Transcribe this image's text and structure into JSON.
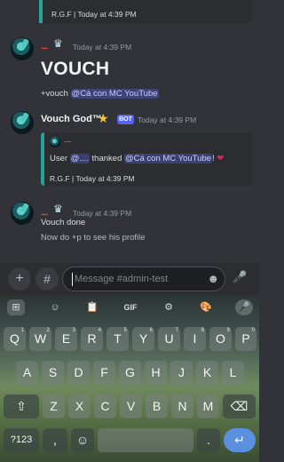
{
  "messages": {
    "top_footer": "R.G.F | Today at 4:39 PM",
    "msg1": {
      "username": "......",
      "time": "Today at 4:39 PM",
      "title": "VOUCH",
      "line_prefix": "+vouch ",
      "mention": "@Cá con MC YouTube"
    },
    "msg2": {
      "username": "Vouch God™",
      "bot_tag": "BOT",
      "time": "Today at 4:39 PM",
      "embed_author": "....",
      "body_prefix": "User ",
      "body_mention1": "@....",
      "body_mid": " thanked ",
      "body_mention2": "@Cá con MC YouTube",
      "body_suffix": "!",
      "heart": "❤",
      "footer": "R.G.F | Today at 4:39 PM"
    },
    "msg3": {
      "username": "......",
      "time": "Today at 4:39 PM",
      "line1": "Vouch done",
      "line2": "Now do +p to see his profile"
    }
  },
  "composer": {
    "placeholder": "Message #admin-test",
    "add_icon": "+",
    "apps_icon": "#",
    "emoji_icon": "☻",
    "mic_icon": "🎤"
  },
  "keyboard": {
    "toolbar": [
      "⊞",
      "☺",
      "📋",
      "GIF",
      "⚙",
      "🎨",
      "🎤"
    ],
    "row1": [
      [
        "Q",
        "1"
      ],
      [
        "W",
        "2"
      ],
      [
        "E",
        "3"
      ],
      [
        "R",
        "4"
      ],
      [
        "T",
        "5"
      ],
      [
        "Y",
        "6"
      ],
      [
        "U",
        "7"
      ],
      [
        "I",
        "8"
      ],
      [
        "O",
        "9"
      ],
      [
        "P",
        "0"
      ]
    ],
    "row2": [
      "A",
      "S",
      "D",
      "F",
      "G",
      "H",
      "J",
      "K",
      "L"
    ],
    "row3": [
      "Z",
      "X",
      "C",
      "V",
      "B",
      "N",
      "M"
    ],
    "shift": "⇧",
    "backspace": "⌫",
    "sym": "?123",
    "comma": ",",
    "emoji": "☺",
    "period": ".",
    "enter": "↵"
  }
}
